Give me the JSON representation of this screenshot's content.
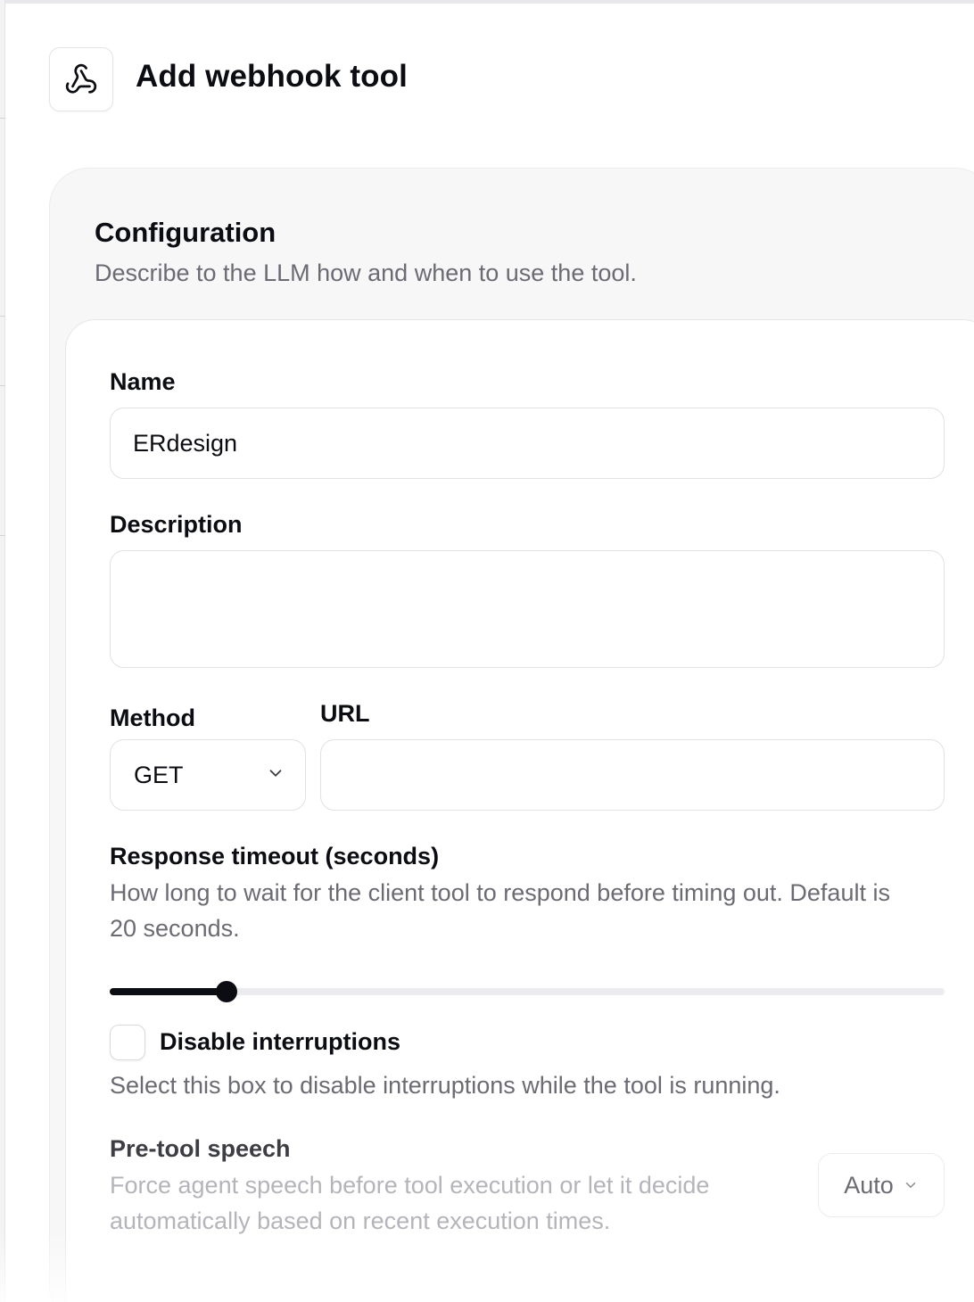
{
  "header": {
    "title": "Add webhook tool",
    "icon": "webhook-icon"
  },
  "configuration": {
    "title": "Configuration",
    "subtitle": "Describe to the LLM how and when to use the tool."
  },
  "form": {
    "name": {
      "label": "Name",
      "value": "ERdesign"
    },
    "description": {
      "label": "Description",
      "value": ""
    },
    "method": {
      "label": "Method",
      "value": "GET",
      "icon": "chevron-down-icon"
    },
    "url": {
      "label": "URL",
      "value": ""
    },
    "timeout": {
      "label": "Response timeout (seconds)",
      "help": "How long to wait for the client tool to respond before timing out. Default is 20 seconds.",
      "slider_fraction": 0.14
    },
    "disable_interruptions": {
      "label": "Disable interruptions",
      "checked": false,
      "help": "Select this box to disable interruptions while the tool is running."
    },
    "pre_tool_speech": {
      "label": "Pre-tool speech",
      "help": "Force agent speech before tool execution or let it decide automatically based on recent execution times.",
      "value": "Auto",
      "icon": "chevron-down-icon"
    }
  },
  "colors": {
    "text_primary": "#0b0d12",
    "text_muted": "#6b6b73",
    "card_bg": "#f7f7f8",
    "border": "#e1e1e6"
  }
}
